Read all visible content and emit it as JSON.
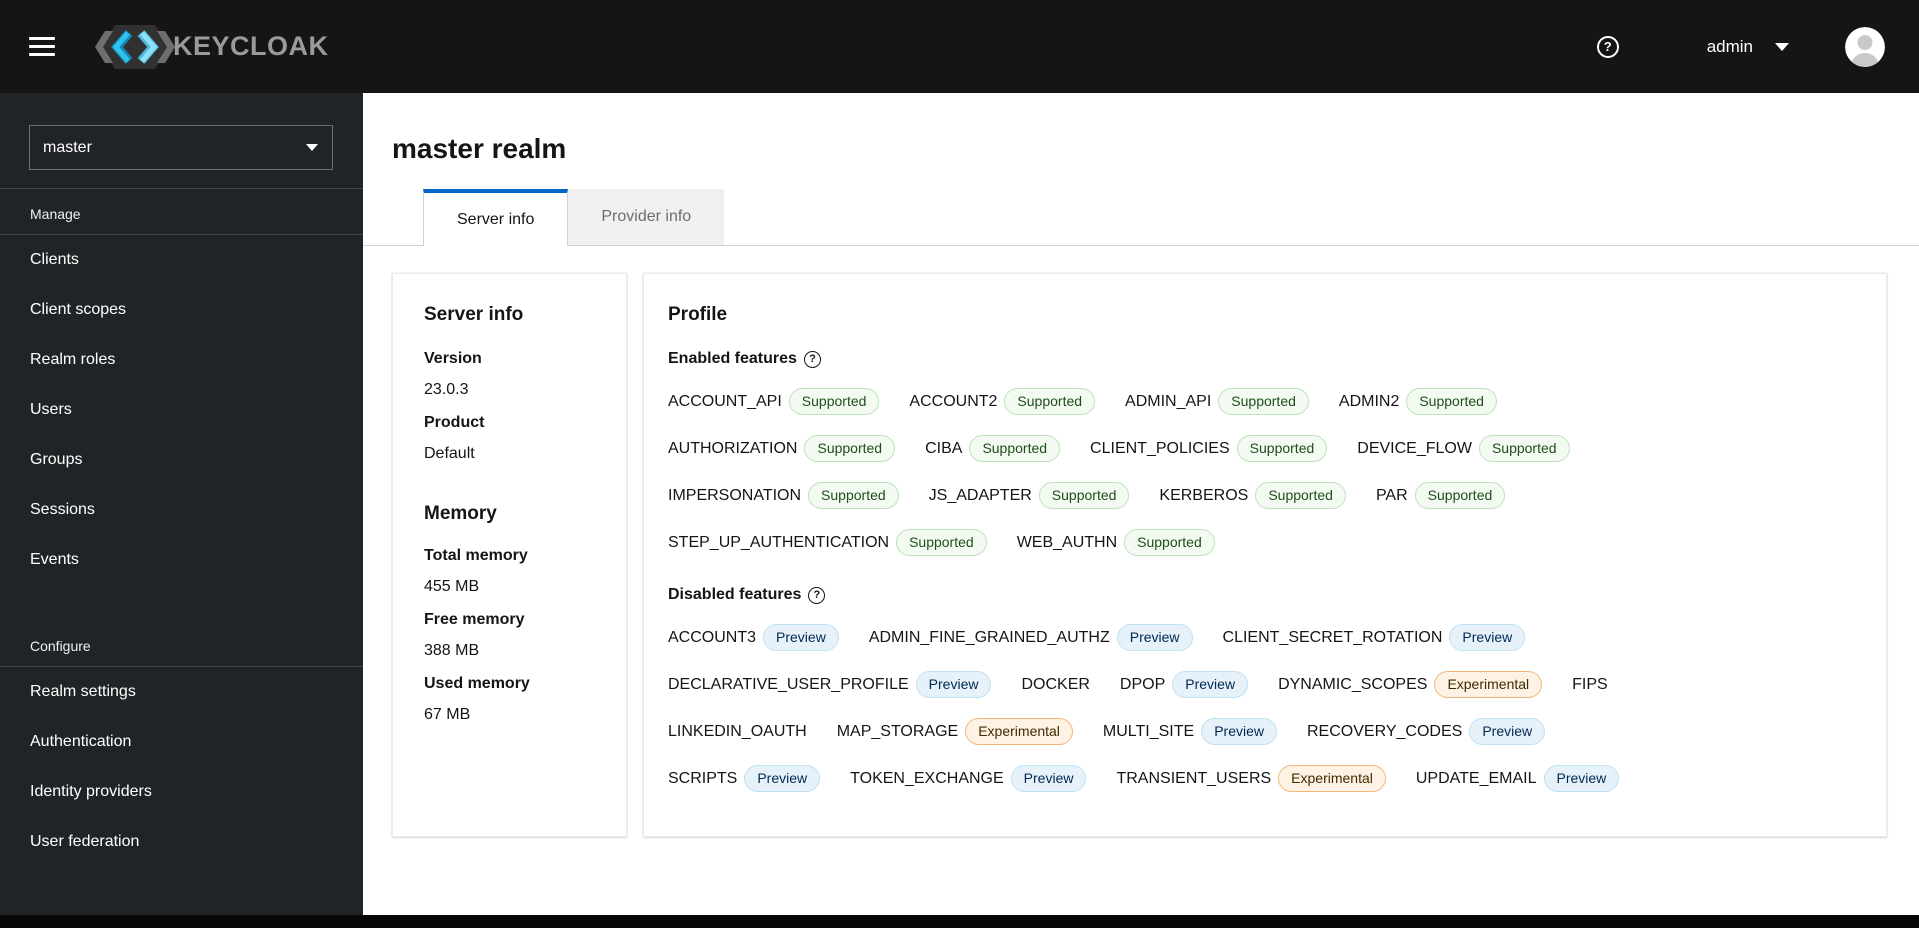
{
  "masthead": {
    "brand": "KEYCLOAK",
    "help_glyph": "?",
    "username": "admin"
  },
  "sidebar": {
    "realm": "master",
    "groups": [
      {
        "title": "Manage",
        "items": [
          "Clients",
          "Client scopes",
          "Realm roles",
          "Users",
          "Groups",
          "Sessions",
          "Events"
        ]
      },
      {
        "title": "Configure",
        "items": [
          "Realm settings",
          "Authentication",
          "Identity providers",
          "User federation"
        ]
      }
    ]
  },
  "page": {
    "title": "master realm",
    "tabs": [
      {
        "label": "Server info",
        "active": true
      },
      {
        "label": "Provider info",
        "active": false
      }
    ]
  },
  "server_info": {
    "sections": [
      {
        "heading": "Server info",
        "fields": [
          {
            "label": "Version",
            "value": "23.0.3"
          },
          {
            "label": "Product",
            "value": "Default"
          }
        ]
      },
      {
        "heading": "Memory",
        "fields": [
          {
            "label": "Total memory",
            "value": "455 MB"
          },
          {
            "label": "Free memory",
            "value": "388 MB"
          },
          {
            "label": "Used memory",
            "value": "67 MB"
          }
        ]
      }
    ]
  },
  "profile": {
    "title": "Profile",
    "enabled_label": "Enabled features",
    "disabled_label": "Disabled features",
    "enabled_rows": [
      [
        [
          "ACCOUNT_API",
          "Supported"
        ],
        [
          "ACCOUNT2",
          "Supported"
        ],
        [
          "ADMIN_API",
          "Supported"
        ],
        [
          "ADMIN2",
          "Supported"
        ]
      ],
      [
        [
          "AUTHORIZATION",
          "Supported"
        ],
        [
          "CIBA",
          "Supported"
        ],
        [
          "CLIENT_POLICIES",
          "Supported"
        ],
        [
          "DEVICE_FLOW",
          "Supported"
        ]
      ],
      [
        [
          "IMPERSONATION",
          "Supported"
        ],
        [
          "JS_ADAPTER",
          "Supported"
        ],
        [
          "KERBEROS",
          "Supported"
        ],
        [
          "PAR",
          "Supported"
        ]
      ],
      [
        [
          "STEP_UP_AUTHENTICATION",
          "Supported"
        ],
        [
          "WEB_AUTHN",
          "Supported"
        ]
      ]
    ],
    "disabled_rows": [
      [
        [
          "ACCOUNT3",
          "Preview"
        ],
        [
          "ADMIN_FINE_GRAINED_AUTHZ",
          "Preview"
        ],
        [
          "CLIENT_SECRET_ROTATION",
          "Preview"
        ]
      ],
      [
        [
          "DECLARATIVE_USER_PROFILE",
          "Preview"
        ],
        [
          "DOCKER",
          null
        ],
        [
          "DPOP",
          "Preview"
        ],
        [
          "DYNAMIC_SCOPES",
          "Experimental"
        ],
        [
          "FIPS",
          null
        ]
      ],
      [
        [
          "LINKEDIN_OAUTH",
          null
        ],
        [
          "MAP_STORAGE",
          "Experimental"
        ],
        [
          "MULTI_SITE",
          "Preview"
        ],
        [
          "RECOVERY_CODES",
          "Preview"
        ]
      ],
      [
        [
          "SCRIPTS",
          "Preview"
        ],
        [
          "TOKEN_EXCHANGE",
          "Preview"
        ],
        [
          "TRANSIENT_USERS",
          "Experimental"
        ],
        [
          "UPDATE_EMAIL",
          "Preview"
        ]
      ]
    ]
  },
  "badge_styles": {
    "Supported": {
      "bg": "#f3faf2",
      "border": "#bde2b9",
      "text": "#1e4f18"
    },
    "Preview": {
      "bg": "#e7f1fa",
      "border": "#bee1f4",
      "text": "#002952"
    },
    "Experimental": {
      "bg": "#fdf2e4",
      "border": "#f4b678",
      "text": "#3d2c00"
    }
  },
  "colors": {
    "tab_active_accent": "#0066cc",
    "masthead_bg": "#151515",
    "sidebar_bg": "#212427"
  }
}
